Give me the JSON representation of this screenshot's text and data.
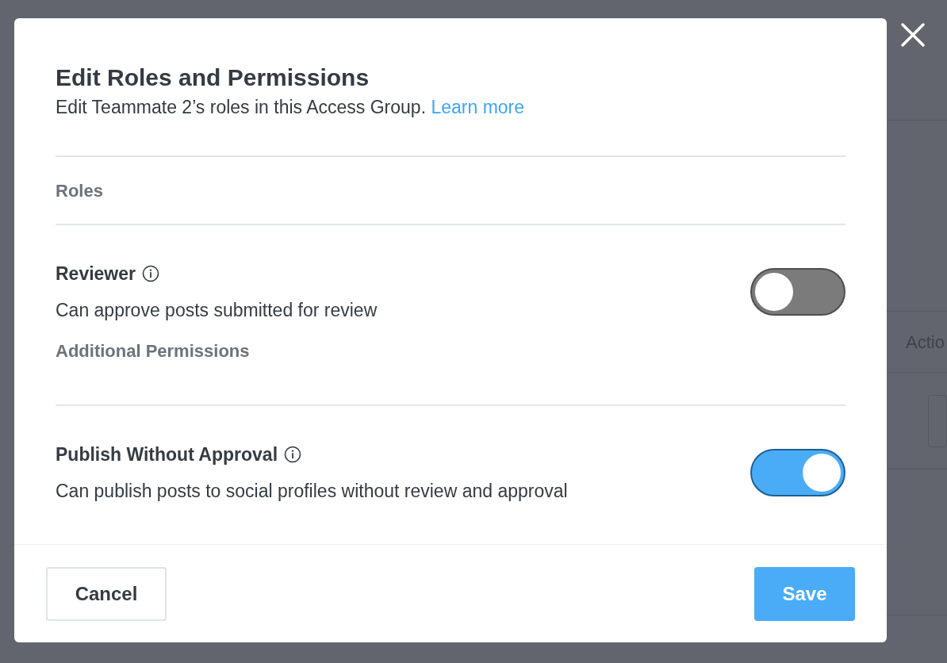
{
  "background": {
    "column_header": "Actio"
  },
  "dialog": {
    "title": "Edit Roles and Permissions",
    "subtitle": "Edit Teammate 2’s roles in this Access Group.",
    "link": "Learn more",
    "sections": [
      {
        "heading": "Roles",
        "items": [
          {
            "name": "Reviewer",
            "description": "Can approve posts submitted for review",
            "on": false
          }
        ]
      },
      {
        "heading": "Additional Permissions",
        "items": [
          {
            "name": "Publish Without Approval",
            "description": "Can publish posts to social profiles without review and approval",
            "on": true
          }
        ]
      }
    ],
    "buttons": [
      {
        "label": "Cancel",
        "kind": "secondary"
      },
      {
        "label": "Save",
        "kind": "primary"
      }
    ]
  }
}
